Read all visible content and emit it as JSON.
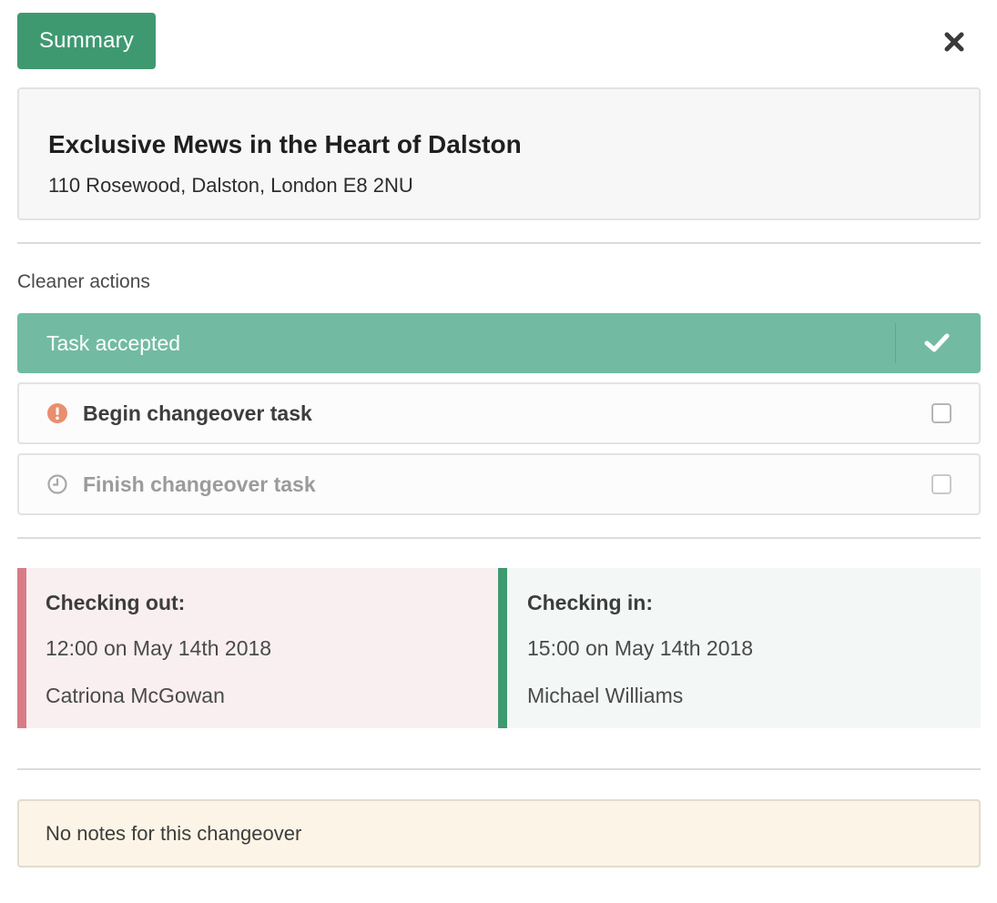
{
  "header": {
    "summary_label": "Summary",
    "close_icon": "close-icon"
  },
  "property": {
    "title": "Exclusive Mews in the Heart of Dalston",
    "address": "110 Rosewood, Dalston, London E8 2NU"
  },
  "cleaner_actions": {
    "section_label": "Cleaner actions",
    "items": [
      {
        "label": "Task accepted",
        "status": "done",
        "icon": "check-icon",
        "color": "#72bba2"
      },
      {
        "label": "Begin changeover task",
        "status": "pending",
        "icon": "alert-icon",
        "color": "#e98e6e",
        "checked": false
      },
      {
        "label": "Finish changeover task",
        "status": "waiting",
        "icon": "clock-icon",
        "color": "#9b9b9b",
        "checked": false
      }
    ]
  },
  "stays": {
    "checkout": {
      "heading": "Checking out:",
      "time": "12:00 on May 14th 2018",
      "guest": "Catriona McGowan",
      "accent": "#d97b87"
    },
    "checkin": {
      "heading": "Checking in:",
      "time": "15:00 on May 14th 2018",
      "guest": "Michael Williams",
      "accent": "#3f9970"
    }
  },
  "notes": {
    "text": "No notes for this changeover"
  },
  "colors": {
    "brand_green": "#3f9970",
    "accepted_green": "#72bba2",
    "warning_orange": "#e98e6e"
  }
}
